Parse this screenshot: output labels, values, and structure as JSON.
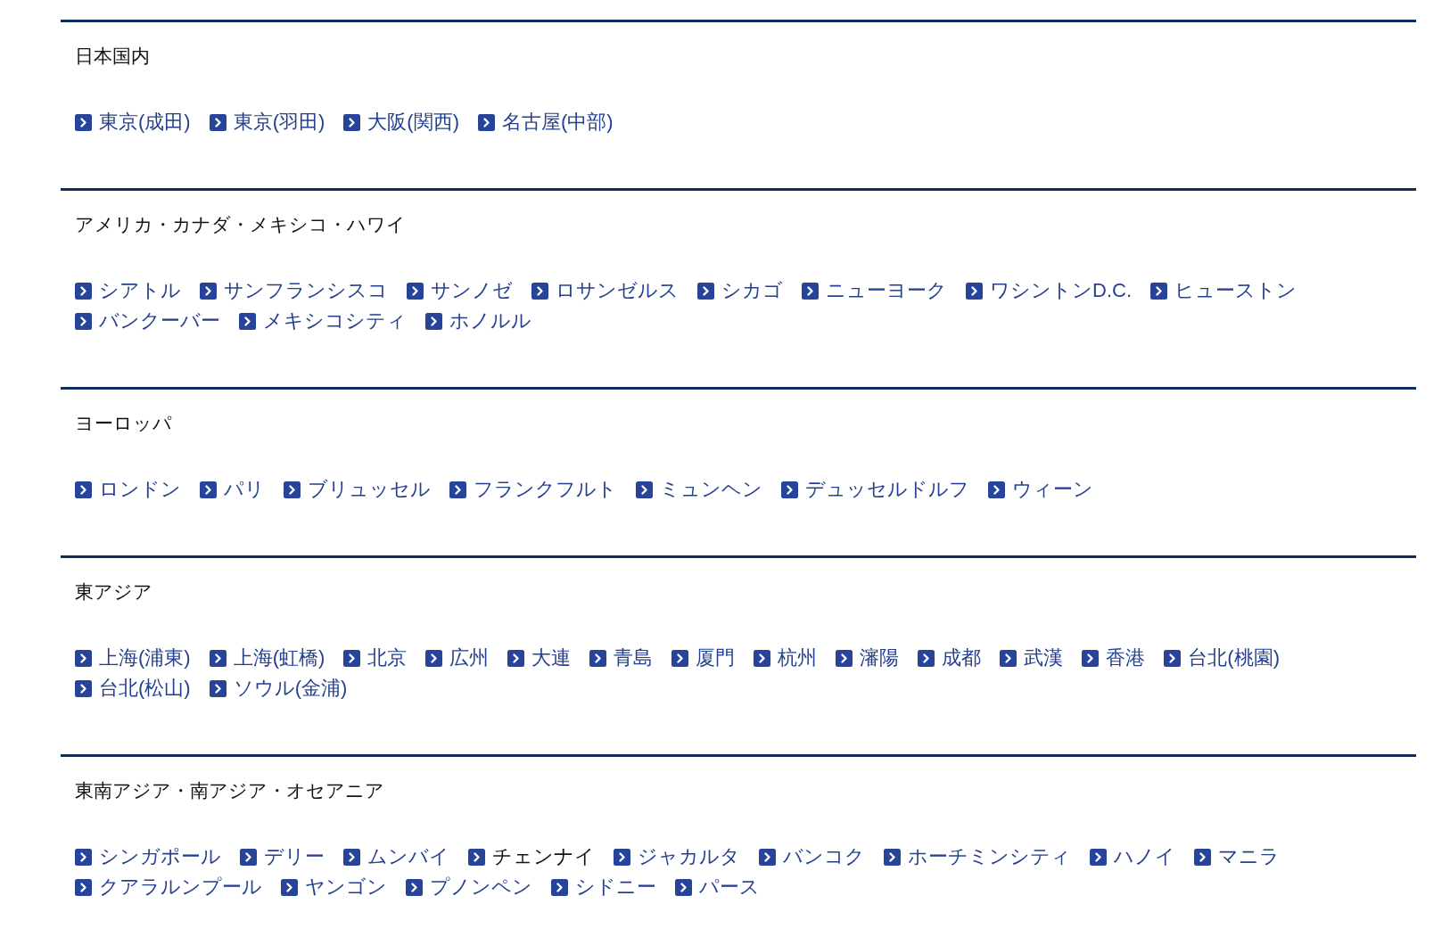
{
  "sections": [
    {
      "heading": "日本国内",
      "links": [
        {
          "label": "東京(成田)",
          "hovered": false
        },
        {
          "label": "東京(羽田)",
          "hovered": false
        },
        {
          "label": "大阪(関西)",
          "hovered": false
        },
        {
          "label": "名古屋(中部)",
          "hovered": false
        }
      ]
    },
    {
      "heading": "アメリカ・カナダ・メキシコ・ハワイ",
      "links": [
        {
          "label": "シアトル",
          "hovered": false
        },
        {
          "label": "サンフランシスコ",
          "hovered": false
        },
        {
          "label": "サンノゼ",
          "hovered": false
        },
        {
          "label": "ロサンゼルス",
          "hovered": false
        },
        {
          "label": "シカゴ",
          "hovered": false
        },
        {
          "label": "ニューヨーク",
          "hovered": false
        },
        {
          "label": "ワシントンD.C.",
          "hovered": false
        },
        {
          "label": "ヒューストン",
          "hovered": false
        },
        {
          "label": "バンクーバー",
          "hovered": false
        },
        {
          "label": "メキシコシティ",
          "hovered": false
        },
        {
          "label": "ホノルル",
          "hovered": false
        }
      ]
    },
    {
      "heading": "ヨーロッパ",
      "links": [
        {
          "label": "ロンドン",
          "hovered": false
        },
        {
          "label": "パリ",
          "hovered": false
        },
        {
          "label": "ブリュッセル",
          "hovered": false
        },
        {
          "label": "フランクフルト",
          "hovered": false
        },
        {
          "label": "ミュンヘン",
          "hovered": false
        },
        {
          "label": "デュッセルドルフ",
          "hovered": false
        },
        {
          "label": "ウィーン",
          "hovered": false
        }
      ]
    },
    {
      "heading": "東アジア",
      "links": [
        {
          "label": "上海(浦東)",
          "hovered": false
        },
        {
          "label": "上海(虹橋)",
          "hovered": false
        },
        {
          "label": "北京",
          "hovered": false
        },
        {
          "label": "広州",
          "hovered": false
        },
        {
          "label": "大連",
          "hovered": false
        },
        {
          "label": "青島",
          "hovered": false
        },
        {
          "label": "厦門",
          "hovered": false
        },
        {
          "label": "杭州",
          "hovered": false
        },
        {
          "label": "瀋陽",
          "hovered": false
        },
        {
          "label": "成都",
          "hovered": false
        },
        {
          "label": "武漢",
          "hovered": false
        },
        {
          "label": "香港",
          "hovered": false
        },
        {
          "label": "台北(桃園)",
          "hovered": false
        },
        {
          "label": "台北(松山)",
          "hovered": false
        },
        {
          "label": "ソウル(金浦)",
          "hovered": false
        }
      ]
    },
    {
      "heading": "東南アジア・南アジア・オセアニア",
      "links": [
        {
          "label": "シンガポール",
          "hovered": false
        },
        {
          "label": "デリー",
          "hovered": false
        },
        {
          "label": "ムンバイ",
          "hovered": false
        },
        {
          "label": "チェンナイ",
          "hovered": true
        },
        {
          "label": "ジャカルタ",
          "hovered": false
        },
        {
          "label": "バンコク",
          "hovered": false
        },
        {
          "label": "ホーチミンシティ",
          "hovered": false
        },
        {
          "label": "ハノイ",
          "hovered": false
        },
        {
          "label": "マニラ",
          "hovered": false
        },
        {
          "label": "クアラルンプール",
          "hovered": false
        },
        {
          "label": "ヤンゴン",
          "hovered": false
        },
        {
          "label": "プノンペン",
          "hovered": false
        },
        {
          "label": "シドニー",
          "hovered": false
        },
        {
          "label": "パース",
          "hovered": false
        }
      ]
    }
  ]
}
